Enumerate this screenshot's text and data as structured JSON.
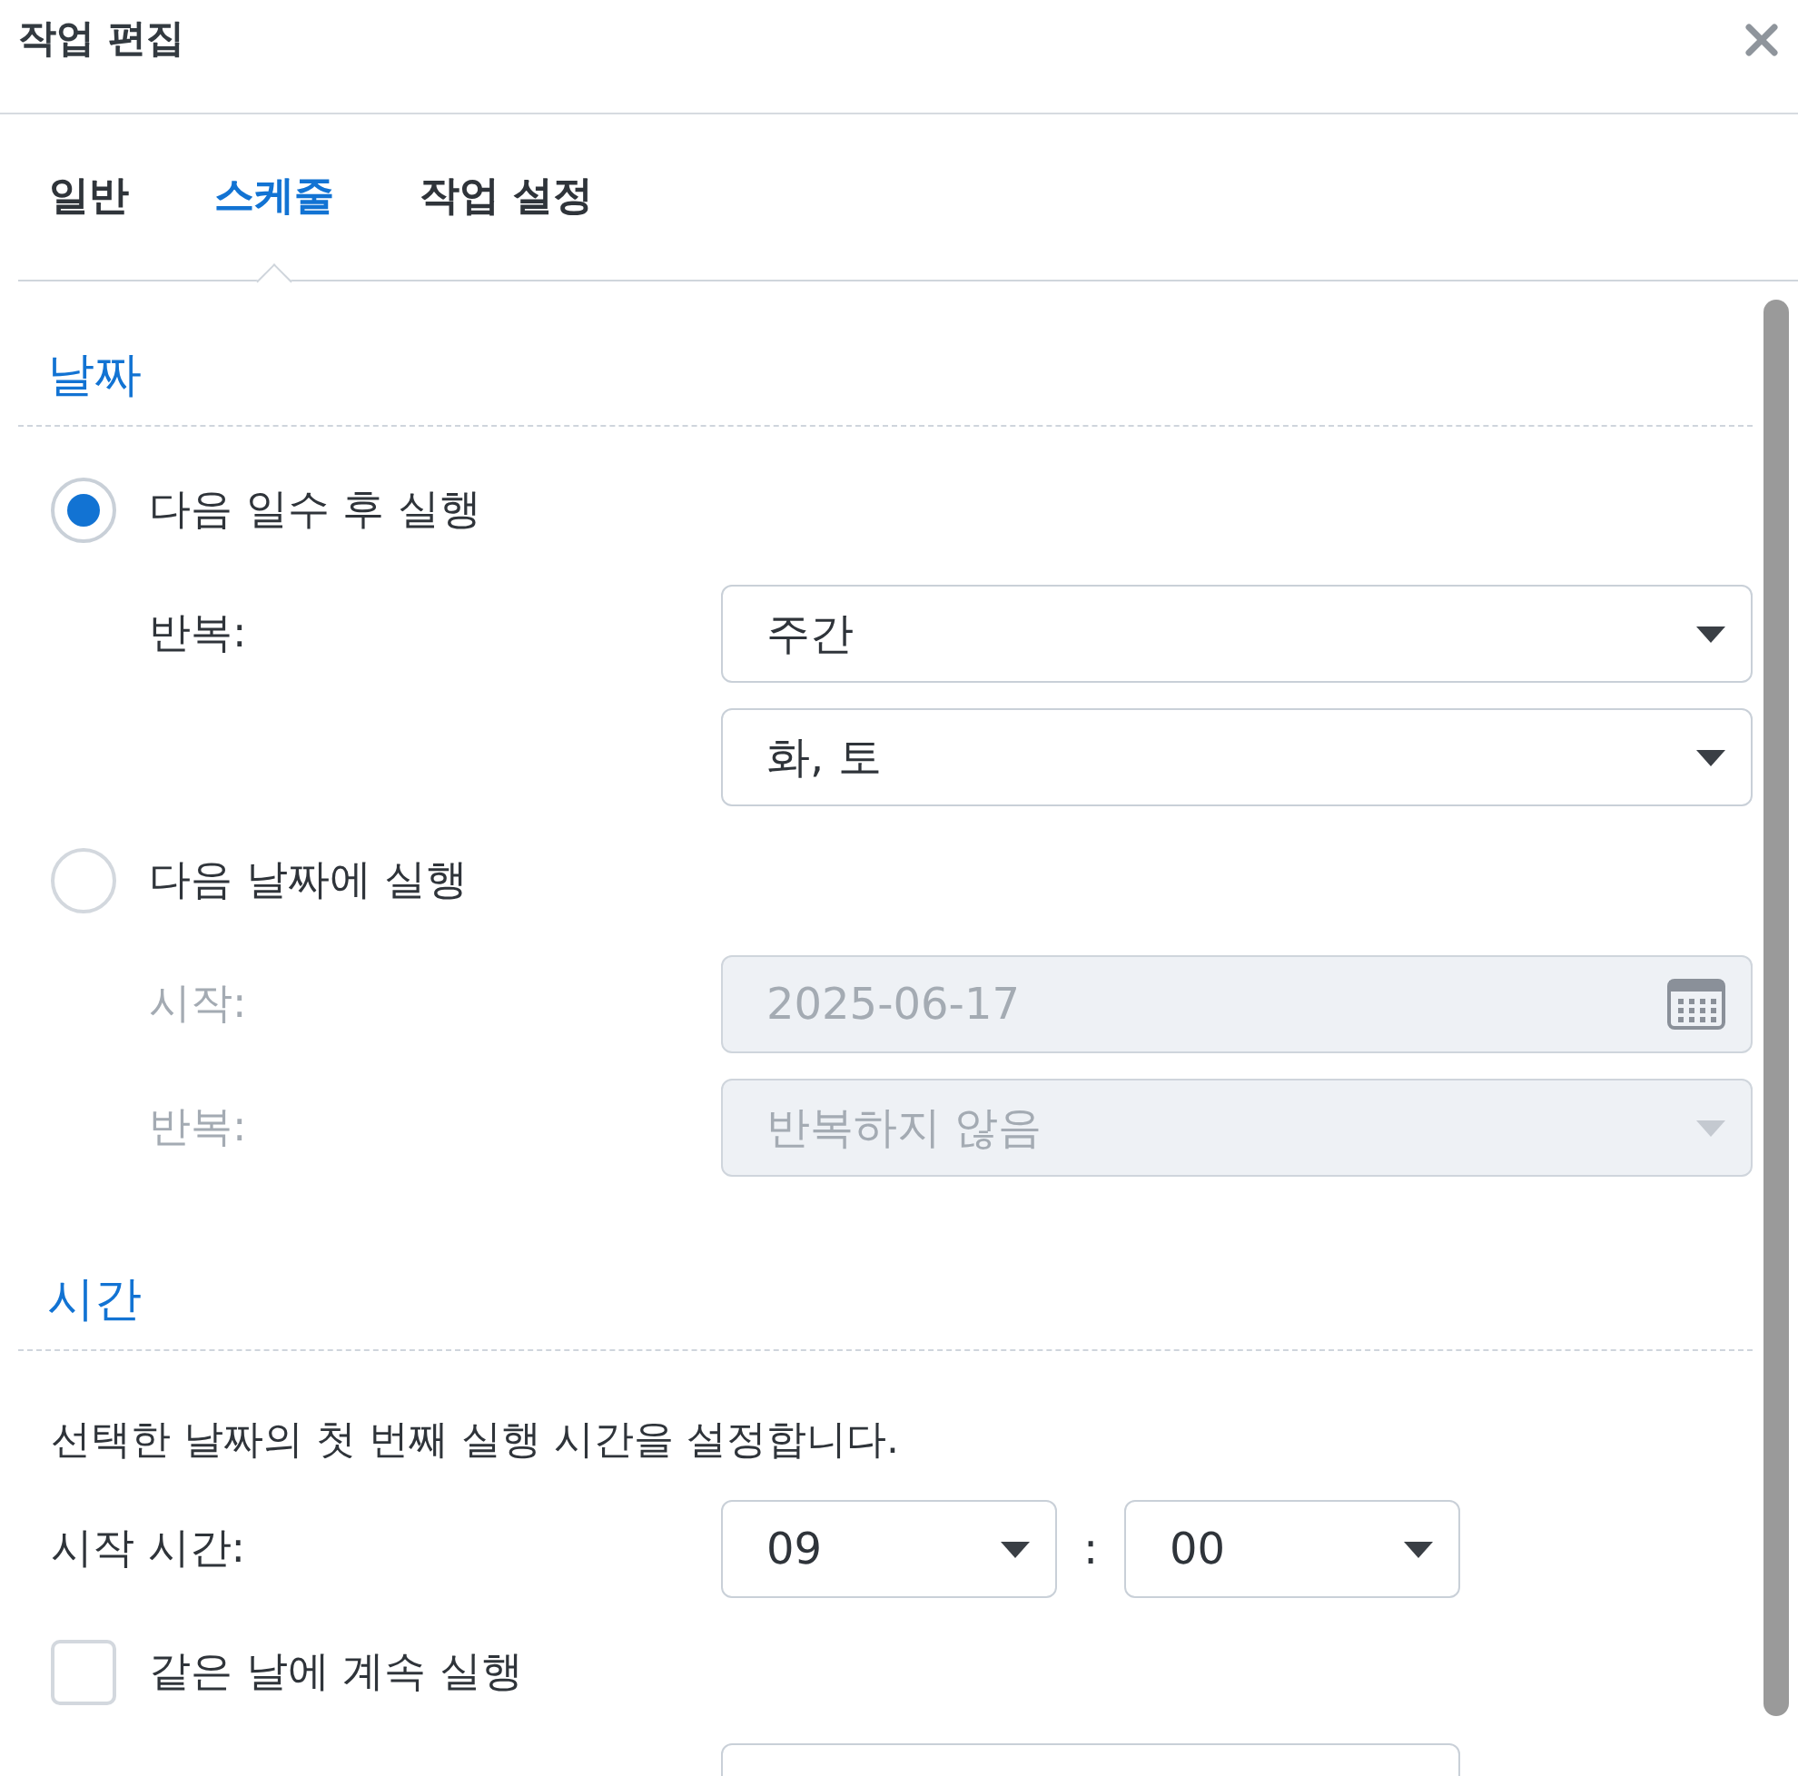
{
  "window": {
    "title": "작업 편집"
  },
  "tabs": [
    {
      "label": "일반",
      "selected": false
    },
    {
      "label": "스케줄",
      "selected": true
    },
    {
      "label": "작업 설정",
      "selected": false
    }
  ],
  "date_section": {
    "title": "날짜",
    "options": [
      {
        "label": "다음 일수 후 실행",
        "selected": true,
        "rows": [
          {
            "label": "반복:",
            "field": {
              "kind": "dropdown",
              "value": "주간"
            }
          },
          {
            "field": {
              "kind": "dropdown",
              "value": "화, 토"
            }
          }
        ]
      },
      {
        "label": "다음 날짜에 실행",
        "selected": false,
        "rows": [
          {
            "label": "시작:",
            "field": {
              "kind": "date",
              "value": "2025-06-17"
            }
          },
          {
            "label": "반복:",
            "field": {
              "kind": "dropdown",
              "value": "반복하지 않음"
            }
          }
        ]
      }
    ]
  },
  "time_section": {
    "title": "시간",
    "description": "선택한 날짜의 첫 번째 실행 시간을 설정합니다.",
    "start_time": {
      "label": "시작 시간:",
      "hour": "09",
      "separator": ":",
      "minute": "00"
    },
    "continue_same_day": {
      "label": "같은 날에 계속 실행",
      "checked": false
    }
  }
}
